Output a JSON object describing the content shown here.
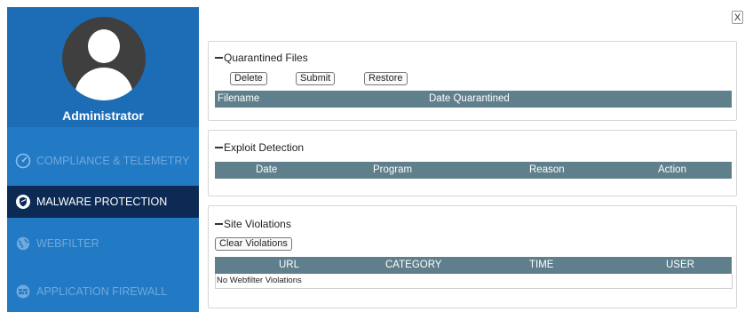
{
  "sidebar": {
    "profile_name": "Administrator",
    "items": [
      {
        "label": "COMPLIANCE & TELEMETRY",
        "icon": "gauge-icon"
      },
      {
        "label": "MALWARE PROTECTION",
        "icon": "shield-icon"
      },
      {
        "label": "WEBFILTER",
        "icon": "globe-icon"
      },
      {
        "label": "APPLICATION FIREWALL",
        "icon": "firewall-icon"
      }
    ]
  },
  "close_label": "X",
  "quarantine": {
    "title": "Quarantined Files",
    "buttons": {
      "delete": "Delete",
      "submit": "Submit",
      "restore": "Restore"
    },
    "columns": [
      "Filename",
      "Date Quarantined"
    ]
  },
  "exploit": {
    "title": "Exploit Detection",
    "columns": [
      "Date",
      "Program",
      "Reason",
      "Action"
    ]
  },
  "sites": {
    "title": "Site Violations",
    "clear_label": "Clear Violations",
    "columns": [
      "URL",
      "CATEGORY",
      "TIME",
      "USER"
    ],
    "empty_message": "No Webfilter Violations"
  },
  "colors": {
    "sidebar": "#2279c4",
    "profile_bg": "#1c6db6",
    "active_item": "#0c2a54",
    "table_header": "#5f7f8c"
  }
}
